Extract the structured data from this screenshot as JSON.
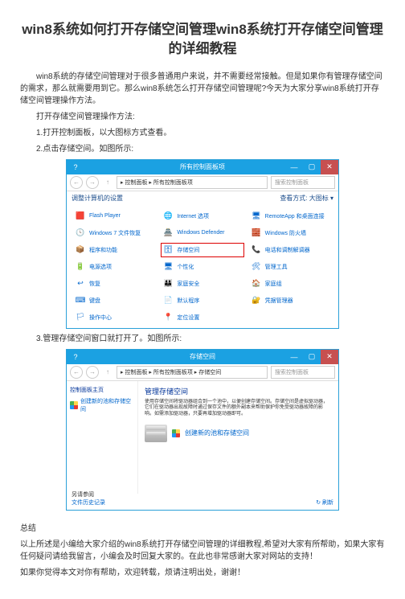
{
  "title": "win8系统如何打开存储空间管理win8系统打开存储空间管理的详细教程",
  "intro": "win8系统的存储空间管理对于很多普通用户来说，并不需要经常接触。但是如果你有管理存储空间的需求，那么就需要用到它。那么win8系统怎么打开存储空间管理呢?今天为大家分享win8系统打开存储空间管理操作方法。",
  "steps_heading": "打开存储空间管理操作方法:",
  "step1": "1.打开控制面板，以大图标方式查看。",
  "step2": "2.点击存储空间。如图所示:",
  "step3": "3.管理存储空间窗口就打开了。如图所示:",
  "summary_h": "总结",
  "summary1": "以上所述是小编给大家介绍的win8系统打开存储空间管理的详细教程,希望对大家有所帮助，如果大家有任何疑问请给我留言，小编会及时回复大家的。在此也非常感谢大家对网站的支持！",
  "summary2": "如果你觉得本文对你有帮助，欢迎转载，烦请注明出处，谢谢！",
  "cp_window": {
    "title": "所有控制面板项",
    "breadcrumb": "▸ 控制面板 ▸ 所有控制面板项",
    "search_ph": "搜索控制面板",
    "heading": "调整计算机的设置",
    "view_label": "查看方式: 大图标 ▾",
    "items": [
      {
        "label": "Flash Player",
        "icon": "🟥",
        "bg": "#fff"
      },
      {
        "label": "Internet 选项",
        "icon": "🌐",
        "bg": "#fff"
      },
      {
        "label": "RemoteApp 和桌面连接",
        "icon": "🖥",
        "bg": "#fff"
      },
      {
        "label": "Windows 7 文件恢复",
        "icon": "🕓",
        "bg": "#fff"
      },
      {
        "label": "Windows Defender",
        "icon": "🏯",
        "bg": "#fff"
      },
      {
        "label": "Windows 防火墙",
        "icon": "🧱",
        "bg": "#fff"
      },
      {
        "label": "程序和功能",
        "icon": "📦",
        "bg": "#fff"
      },
      {
        "label": "存储空间",
        "icon": "🗄",
        "bg": "#fff",
        "highlight": true
      },
      {
        "label": "电话和调制解调器",
        "icon": "📞",
        "bg": "#fff"
      },
      {
        "label": "电源选项",
        "icon": "🔋",
        "bg": "#fff"
      },
      {
        "label": "个性化",
        "icon": "🖥",
        "bg": "#fff"
      },
      {
        "label": "管理工具",
        "icon": "🛠",
        "bg": "#fff"
      },
      {
        "label": "恢复",
        "icon": "↩",
        "bg": "#fff"
      },
      {
        "label": "家庭安全",
        "icon": "👪",
        "bg": "#fff"
      },
      {
        "label": "家庭组",
        "icon": "🏠",
        "bg": "#fff"
      },
      {
        "label": "键盘",
        "icon": "⌨",
        "bg": "#fff"
      },
      {
        "label": "默认程序",
        "icon": "📄",
        "bg": "#fff"
      },
      {
        "label": "凭据管理器",
        "icon": "🔐",
        "bg": "#fff"
      },
      {
        "label": "操作中心",
        "icon": "🏳",
        "bg": "#fff"
      },
      {
        "label": "定位设置",
        "icon": "📍",
        "bg": "#fff"
      }
    ]
  },
  "ss_window": {
    "title": "存储空间",
    "breadcrumb": "▸ 控制面板 ▸ 所有控制面板项 ▸ 存储空间",
    "search_ph": "搜索控制面板",
    "sidebar_h": "控制面板主页",
    "sidebar_link": "创建新的池和存储空间",
    "main_h": "管理存储空间",
    "desc": "使用存储空间将驱动器组合到一个池中，以便创建存储空间。存储空间是虚拟驱动器，它们在驱动器出现故障时通过保存文件的额外副本来帮助保护你免受驱动器故障的影响。如需添加驱动器，只要再增加驱动器即可。",
    "create_link": "创建新的池和存储空间",
    "refresh": "↻ 刷新",
    "seealso_h": "另请参阅",
    "seealso_link": "文件历史记录"
  }
}
